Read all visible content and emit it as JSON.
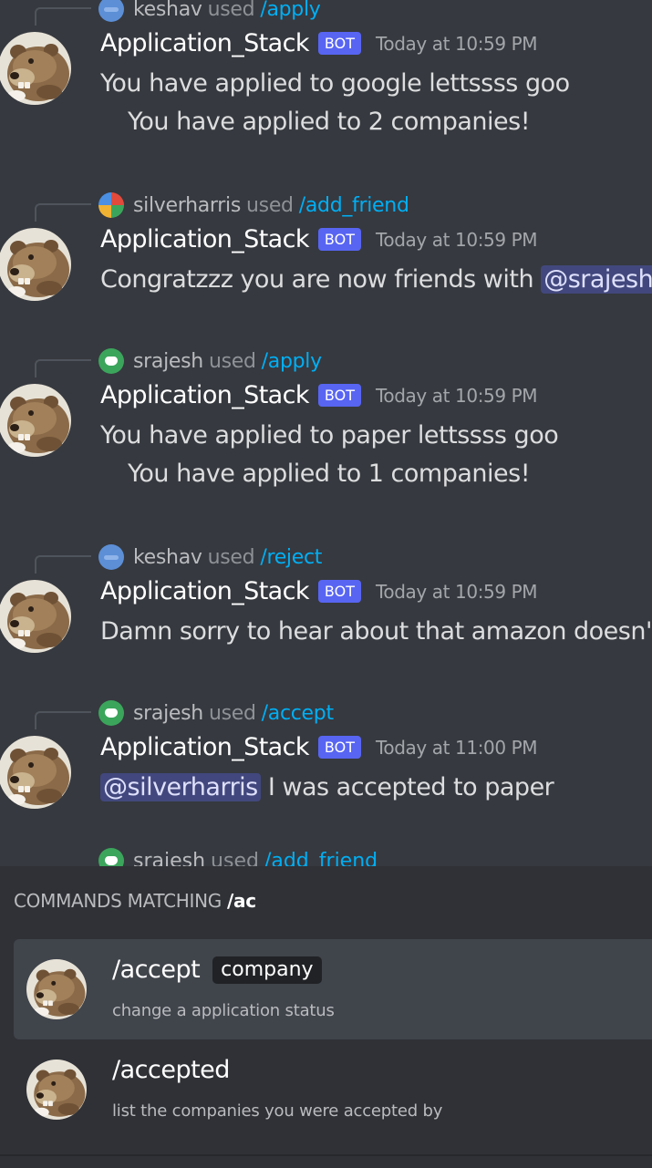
{
  "messages": [
    {
      "reply_user": "keshav",
      "reply_used": "used",
      "reply_command": "/apply",
      "reply_avatar": "blue",
      "author": "Application_Stack",
      "bot_tag": "BOT",
      "timestamp": "Today at 10:59 PM",
      "line1": "You have applied to google lettssss goo",
      "line2": "You have applied to 2 companies!"
    },
    {
      "reply_user": "silverharris",
      "reply_used": "used",
      "reply_command": "/add_friend",
      "reply_avatar": "multi",
      "author": "Application_Stack",
      "bot_tag": "BOT",
      "timestamp": "Today at 10:59 PM",
      "line1_text": "Congratzzz you are now friends with ",
      "line1_mention": "@srajesh"
    },
    {
      "reply_user": "srajesh",
      "reply_used": "used",
      "reply_command": "/apply",
      "reply_avatar": "green",
      "author": "Application_Stack",
      "bot_tag": "BOT",
      "timestamp": "Today at 10:59 PM",
      "line1": "You have applied to paper lettssss goo",
      "line2": "You have applied to 1 companies!"
    },
    {
      "reply_user": "keshav",
      "reply_used": "used",
      "reply_command": "/reject",
      "reply_avatar": "blue",
      "author": "Application_Stack",
      "bot_tag": "BOT",
      "timestamp": "Today at 10:59 PM",
      "line1": "Damn sorry to hear about that amazon doesn't"
    },
    {
      "reply_user": "srajesh",
      "reply_used": "used",
      "reply_command": "/accept",
      "reply_avatar": "green",
      "author": "Application_Stack",
      "bot_tag": "BOT",
      "timestamp": "Today at 11:00 PM",
      "line1_mention": "@silverharris",
      "line1_text": " I was accepted to paper"
    }
  ],
  "peek": {
    "reply_user": "srajesh",
    "reply_used": "used",
    "reply_command": "/add_friend"
  },
  "command_popup": {
    "title_prefix": "COMMANDS MATCHING",
    "query": "/ac",
    "commands": [
      {
        "name": "/accept",
        "option": "company",
        "description": "change a application status",
        "selected": true
      },
      {
        "name": "/accepted",
        "description": "list the companies you were accepted by",
        "selected": false
      }
    ]
  },
  "colors": {
    "background": "#36393f",
    "popup_background": "#2f3136",
    "bot_tag": "#5865f2",
    "command_link": "#00aff4"
  },
  "icons": {
    "bot_avatar": "bear-avatar-icon"
  }
}
